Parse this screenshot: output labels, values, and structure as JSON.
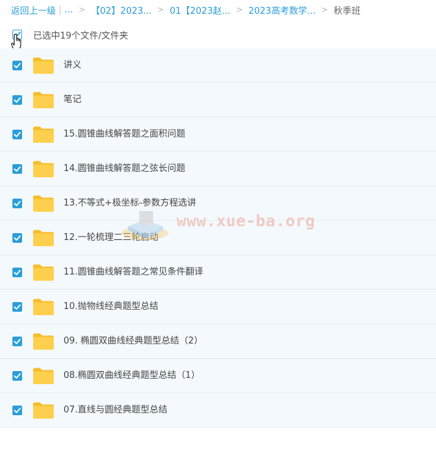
{
  "breadcrumb": {
    "back": "返回上一级",
    "divider": "|",
    "ellipsis": "...",
    "sep": ">",
    "items": [
      "【02】2023...",
      "01【2023赵...",
      "2023高考数学..."
    ],
    "current": "秋季班"
  },
  "selection": {
    "label": "已选中19个文件/文件夹"
  },
  "folders": [
    "讲义",
    "笔记",
    "15.圆锥曲线解答题之面积问题",
    "14.圆锥曲线解答题之弦长问题",
    "13.不等式+极坐标-参数方程选讲",
    "12.一轮梳理二三轮启动",
    "11.圆锥曲线解答题之常见条件翻译",
    "10.抛物线经典题型总结",
    "09. 椭圆双曲线经典题型总结（2）",
    "08.椭圆双曲线经典题型总结（1）",
    "07.直线与圆经典题型总结"
  ],
  "watermark": "www.xue-ba.org",
  "colors": {
    "accent": "#2a9ed8",
    "row_bg": "#f4f9fd",
    "folder": "#ffd04d"
  }
}
